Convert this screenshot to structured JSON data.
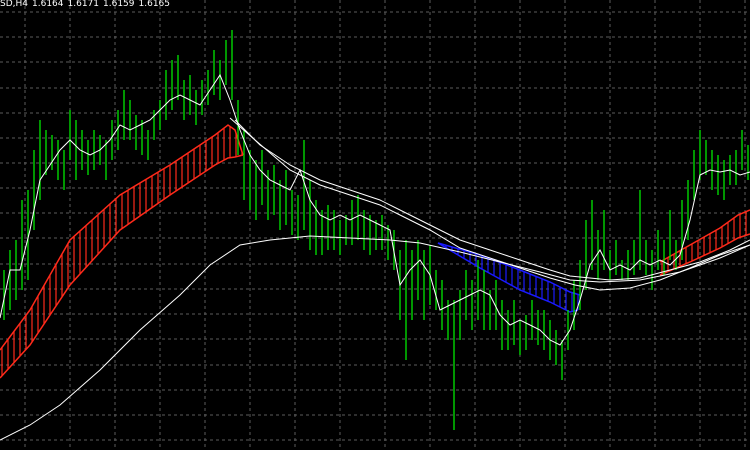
{
  "header": {
    "symbol_timeframe": "SD,H4",
    "quotes": [
      "1.6164",
      "1.6171",
      "1.6159",
      "1.6165"
    ]
  },
  "colors": {
    "background": "#000000",
    "grid": "#5c5c5c",
    "bars": "#00e600",
    "moving_averages": "#ffffff",
    "bear_band": "#ff2a1a",
    "bull_band": "#1a1aff"
  },
  "chart_data": {
    "type": "line",
    "description_units": "price",
    "ylim": [
      1.58,
      1.66
    ],
    "grid": true
  }
}
